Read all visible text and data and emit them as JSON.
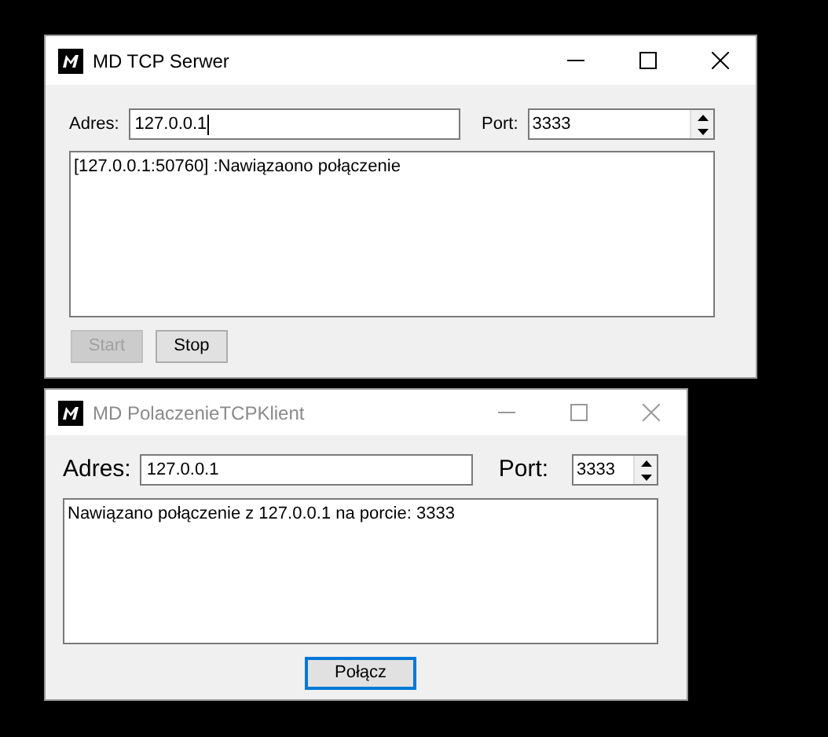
{
  "windows": [
    {
      "title": "MD TCP Serwer",
      "active": true,
      "large_labels": false,
      "address_label": "Adres:",
      "address": "127.0.0.1",
      "address_caret": true,
      "port_label": "Port:",
      "port": "3333",
      "log": [
        "[127.0.0.1:50760] :Nawiązaono połączenie"
      ],
      "buttons": [
        {
          "label": "Start",
          "disabled": true,
          "focused": false
        },
        {
          "label": "Stop",
          "disabled": false,
          "focused": false
        }
      ]
    },
    {
      "title": "MD PolaczenieTCPKlient",
      "active": false,
      "large_labels": true,
      "address_label": "Adres:",
      "address": "127.0.0.1",
      "address_caret": false,
      "port_label": "Port:",
      "port": "3333",
      "log": [
        "Nawiązano połączenie z 127.0.0.1 na porcie: 3333"
      ],
      "buttons": [
        {
          "label": "Połącz",
          "disabled": false,
          "focused": true
        }
      ]
    }
  ]
}
